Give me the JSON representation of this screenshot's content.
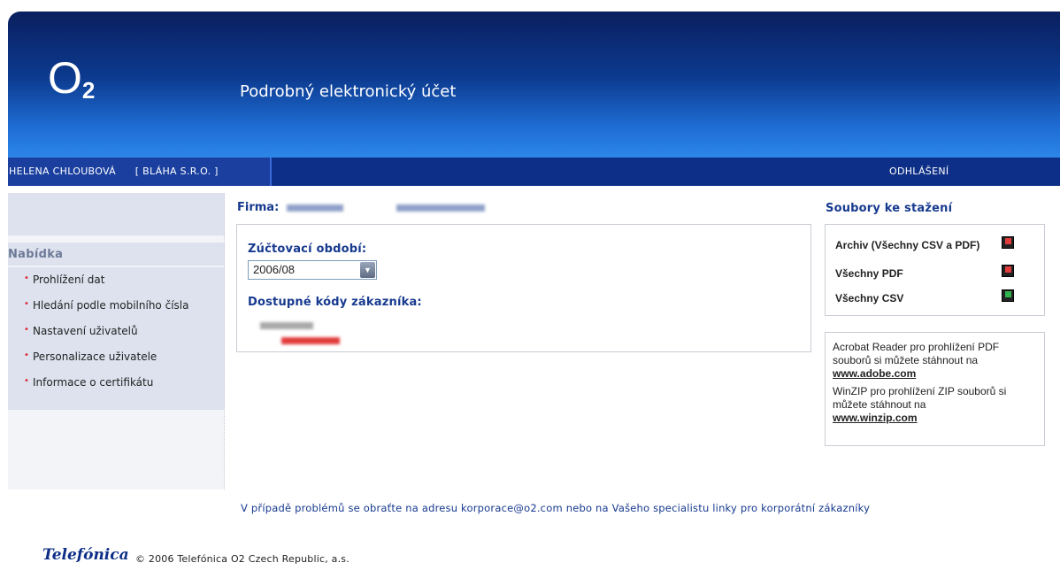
{
  "header": {
    "logo_main": "O",
    "logo_sub": "2",
    "title": "Podrobný elektronický účet"
  },
  "userbar": {
    "user_name": "HELENA CHLOUBOVÁ",
    "company": "[ BLÁHA S.R.O. ]",
    "logout": "ODHLÁŠENÍ"
  },
  "sidebar": {
    "menu_title": "Nabídka",
    "items": [
      {
        "label": "Prohlížení dat"
      },
      {
        "label": "Hledání podle mobilního čísla"
      },
      {
        "label": "Nastavení uživatelů"
      },
      {
        "label": "Personalizace uživatele"
      },
      {
        "label": "Informace o certifikátu"
      }
    ]
  },
  "main": {
    "firma_label": "Firma:",
    "period_label": "Zúčtovací období:",
    "period_value": "2006/08",
    "codes_label": "Dostupné kódy zákazníka:"
  },
  "downloads": {
    "title": "Soubory ke stažení",
    "items": [
      {
        "label": "Archiv (Všechny CSV a PDF)",
        "icon": "archive-disk-icon",
        "color": "#e23b3b"
      },
      {
        "label": "Všechny PDF",
        "icon": "pdf-disk-icon",
        "color": "#e23b3b"
      },
      {
        "label": "Všechny CSV",
        "icon": "csv-disk-icon",
        "color": "#2fb24c"
      }
    ]
  },
  "info": {
    "acrobat_text": "Acrobat Reader pro prohlížení PDF souborů si můžete stáhnout na",
    "acrobat_link": "www.adobe.com",
    "winzip_text": "WinZIP pro prohlížení ZIP souborů si můžete stáhnout na",
    "winzip_link": "www.winzip.com"
  },
  "footer": {
    "note": "V případě problémů se obraťte na adresu korporace@o2.com nebo na Vašeho specialistu linky pro korporátní zákazníky",
    "brand": "Telefónica",
    "copyright": "© 2006 Telefónica O2 Czech Republic, a.s."
  }
}
